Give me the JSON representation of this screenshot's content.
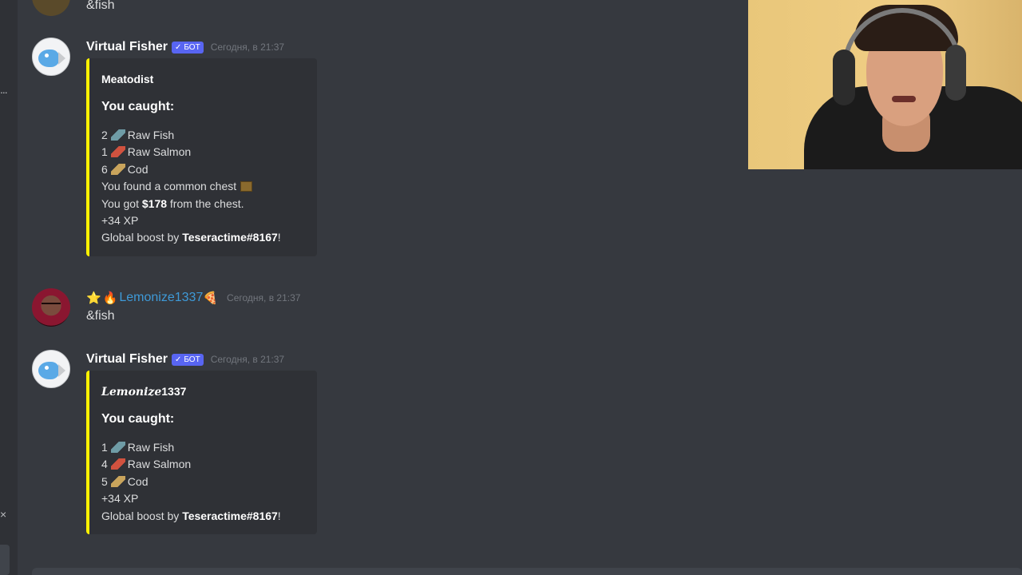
{
  "previous_message": {
    "text": "&fish"
  },
  "messages": [
    {
      "username": "Virtual Fisher",
      "bot_tag": "БОТ",
      "timestamp": "Сегодня, в 21:37",
      "embed": {
        "author": "Meatodist",
        "title": "You caught:",
        "lines": [
          {
            "qty": "2",
            "item": "Raw Fish",
            "icon": "raw-fish-icon"
          },
          {
            "qty": "1",
            "item": "Raw Salmon",
            "icon": "raw-salmon-icon"
          },
          {
            "qty": "6",
            "item": "Cod",
            "icon": "cod-icon"
          }
        ],
        "chest_text": "You found a common chest",
        "money_prefix": "You got",
        "money_amount": "$178",
        "money_suffix": "from the chest.",
        "xp": "+34 XP",
        "boost_prefix": "Global boost by",
        "boost_user": "Teseractime#8167",
        "boost_suffix": "!",
        "accent_color": "#fff200"
      }
    },
    {
      "username": "Lemonize1337",
      "prefix_emojis": [
        "⭐",
        "🔥"
      ],
      "suffix_emoji": "🍕",
      "timestamp": "Сегодня, в 21:37",
      "text": "&fish",
      "name_color": "#3e9ad8"
    },
    {
      "username": "Virtual Fisher",
      "bot_tag": "БОТ",
      "timestamp": "Сегодня, в 21:37",
      "embed": {
        "author_italic": "Lemonize",
        "author_rest": "1337",
        "title": "You caught:",
        "lines": [
          {
            "qty": "1",
            "item": "Raw Fish",
            "icon": "raw-fish-icon"
          },
          {
            "qty": "4",
            "item": "Raw Salmon",
            "icon": "raw-salmon-icon"
          },
          {
            "qty": "5",
            "item": "Cod",
            "icon": "cod-icon"
          }
        ],
        "xp": "+34 XP",
        "boost_prefix": "Global boost by",
        "boost_user": "Teseractime#8167",
        "boost_suffix": "!",
        "accent_color": "#fff200"
      }
    }
  ],
  "sidebar": {
    "dots": "...",
    "close": "×"
  }
}
